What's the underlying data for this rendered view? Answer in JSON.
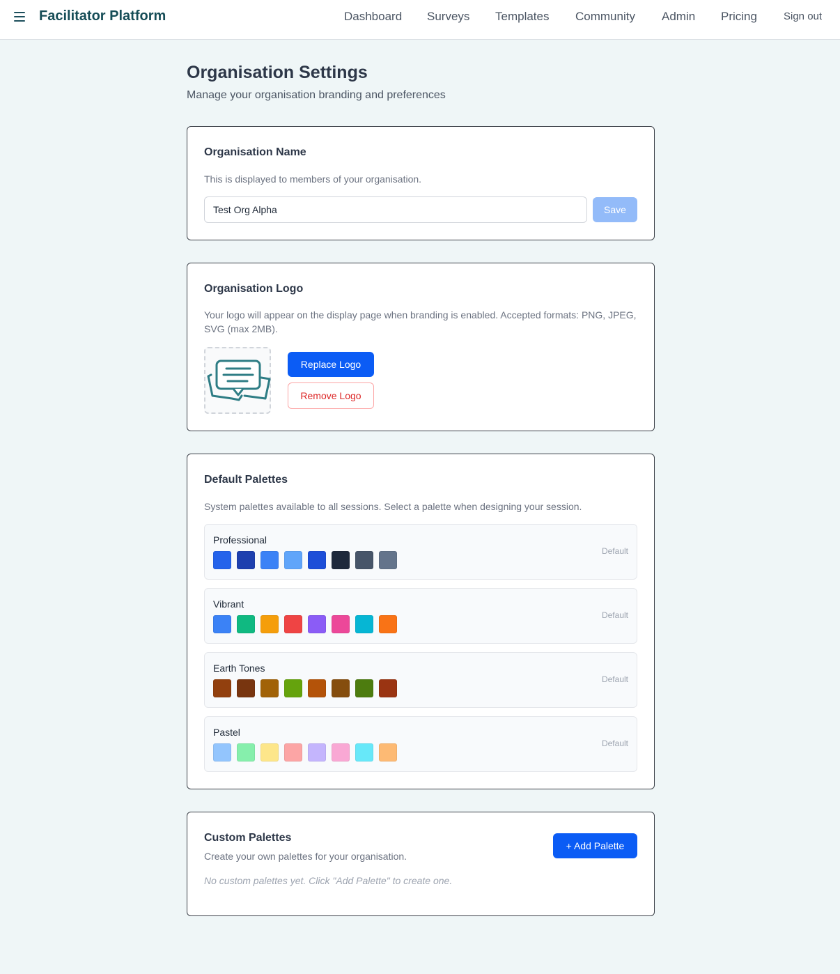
{
  "header": {
    "brand": "Facilitator Platform",
    "nav": [
      "Dashboard",
      "Surveys",
      "Templates",
      "Community",
      "Admin",
      "Pricing"
    ],
    "sign_out": "Sign out"
  },
  "page": {
    "title": "Organisation Settings",
    "subtitle": "Manage your organisation branding and preferences"
  },
  "org_name": {
    "title": "Organisation Name",
    "desc": "This is displayed to members of your organisation.",
    "value": "Test Org Alpha",
    "save_label": "Save"
  },
  "org_logo": {
    "title": "Organisation Logo",
    "desc": "Your logo will appear on the display page when branding is enabled. Accepted formats: PNG, JPEG, SVG (max 2MB).",
    "replace_label": "Replace Logo",
    "remove_label": "Remove Logo",
    "logo_icon": "chat-bubbles-icon"
  },
  "default_palettes": {
    "title": "Default Palettes",
    "desc": "System palettes available to all sessions. Select a palette when designing your session.",
    "items": [
      {
        "name": "Professional",
        "tag": "Default",
        "colors": [
          "#2563eb",
          "#1e40af",
          "#3b82f6",
          "#60a5fa",
          "#1d4ed8",
          "#1e293b",
          "#475569",
          "#64748b"
        ]
      },
      {
        "name": "Vibrant",
        "tag": "Default",
        "colors": [
          "#3b82f6",
          "#10b981",
          "#f59e0b",
          "#ef4444",
          "#8b5cf6",
          "#ec4899",
          "#06b6d4",
          "#f97316"
        ]
      },
      {
        "name": "Earth Tones",
        "tag": "Default",
        "colors": [
          "#92400e",
          "#78350f",
          "#a16207",
          "#65a30d",
          "#b45309",
          "#854d0e",
          "#4d7c0f",
          "#9a3412"
        ]
      },
      {
        "name": "Pastel",
        "tag": "Default",
        "colors": [
          "#93c5fd",
          "#86efac",
          "#fde68a",
          "#fca5a5",
          "#c4b5fd",
          "#f9a8d4",
          "#67e8f9",
          "#fdba74"
        ]
      }
    ]
  },
  "custom_palettes": {
    "title": "Custom Palettes",
    "desc": "Create your own palettes for your organisation.",
    "add_label": "+ Add Palette",
    "empty": "No custom palettes yet. Click \"Add Palette\" to create one."
  }
}
